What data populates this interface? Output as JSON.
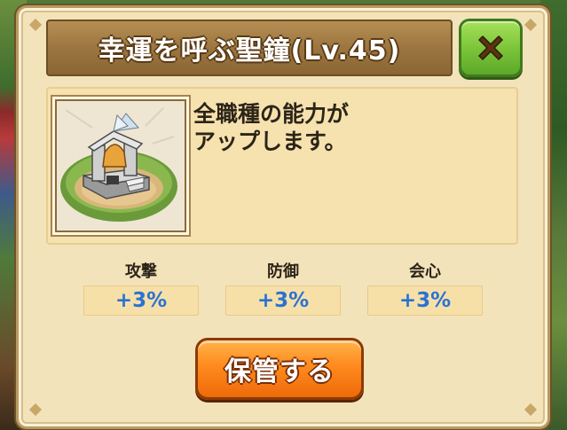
{
  "dialog": {
    "title": "幸運を呼ぶ聖鐘(Lv.45)",
    "close_icon": "close-x-icon"
  },
  "item": {
    "image_icon": "holy-bell-shrine",
    "description_lines": [
      "全職種の能力が",
      "アップします。"
    ]
  },
  "stats": [
    {
      "label": "攻撃",
      "value": "+3%"
    },
    {
      "label": "防御",
      "value": "+3%"
    },
    {
      "label": "会心",
      "value": "+3%"
    }
  ],
  "actions": {
    "store_label": "保管する"
  },
  "colors": {
    "panel_bg": "#f3e3bb",
    "title_bar": "#9c7640",
    "close_button": "#7cc63a",
    "store_button": "#ff8a1e",
    "stat_value": "#2a72d4"
  }
}
